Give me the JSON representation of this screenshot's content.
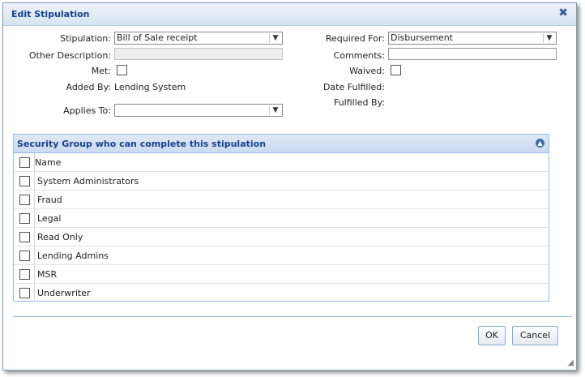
{
  "dialog": {
    "title": "Edit Stipulation"
  },
  "form": {
    "stipulation": {
      "label": "Stipulation:",
      "value": "Bill of Sale receipt"
    },
    "other_description": {
      "label": "Other Description:",
      "value": ""
    },
    "met": {
      "label": "Met:",
      "checked": false
    },
    "added_by": {
      "label": "Added By:",
      "value": "Lending System"
    },
    "applies_to": {
      "label": "Applies To:",
      "value": ""
    },
    "required_for": {
      "label": "Required For:",
      "value": "Disbursement"
    },
    "comments": {
      "label": "Comments:",
      "value": ""
    },
    "waived": {
      "label": "Waived:",
      "checked": false
    },
    "date_fulfilled": {
      "label": "Date Fulfilled:",
      "value": ""
    },
    "fulfilled_by": {
      "label": "Fulfilled By:",
      "value": ""
    }
  },
  "security_group": {
    "title": "Security Group who can complete this stipulation",
    "column_header": "Name",
    "rows": [
      "System Administrators",
      "Fraud",
      "Legal",
      "Read Only",
      "Lending Admins",
      "MSR",
      "Underwriter"
    ]
  },
  "buttons": {
    "ok": "OK",
    "cancel": "Cancel"
  },
  "icons": {
    "close": "close-icon",
    "collapse": "collapse-icon",
    "dropdown": "chevron-down-icon",
    "resize": "resize-grip-icon"
  },
  "colors": {
    "title": "#15428b",
    "border": "#99bbe8"
  }
}
